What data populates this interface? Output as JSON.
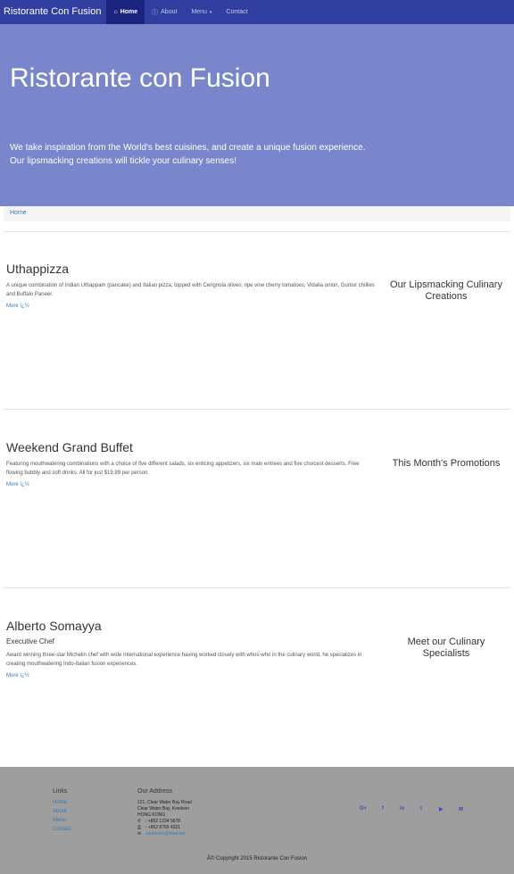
{
  "navbar": {
    "brand": "Ristorante Con Fusion",
    "items": [
      {
        "label": "Home",
        "icon": "home-icon",
        "glyph": "⌂"
      },
      {
        "label": "About",
        "icon": "info-icon",
        "glyph": "ⓘ"
      },
      {
        "label": "Menu",
        "icon": "caret-down-icon",
        "glyph": "▾"
      },
      {
        "label": "Contact"
      }
    ]
  },
  "jumbotron": {
    "title": "Ristorante con Fusion",
    "text": "We take inspiration from the World's best cuisines, and create a unique fusion experience. Our lipsmacking creations will tickle your culinary senses!"
  },
  "breadcrumb": {
    "home": "Home"
  },
  "items": [
    {
      "title": "Uthappizza",
      "description": "A unique combination of Indian Uthappam (pancake) and Italian pizza, topped with Cerignola olives, ripe vine cherry tomatoes, Vidalia onion, Guntur chillies and Buffalo Paneer.",
      "more": "More ï¿½",
      "side": "Our Lipsmacking Culinary Creations"
    },
    {
      "title": "Weekend Grand Buffet",
      "description": "Featuring mouthwatering combinations with a choice of five different salads, six enticing appetizers, six main entrees and five choicest desserts. Free flowing bubbly and soft drinks. All for just $19.99 per person",
      "more": "More ï¿½",
      "side": "This Month's Promotions"
    },
    {
      "title": "Alberto Somayya",
      "subtitle": "Executive Chef",
      "description": "Award winning three-star Michelin chef with wide International experience having worked closely with whos-who in the culinary world, he specializes in creating mouthwatering Indo-Italian fusion experiences.",
      "more": "More ï¿½",
      "side": "Meet our Culinary Specialists"
    }
  ],
  "footer": {
    "links_heading": "Links",
    "links": [
      "Home",
      "About",
      "Menu",
      "Contact"
    ],
    "address_heading": "Our Address",
    "address_lines": [
      "121, Clear Water Bay Road",
      "Clear Water Bay, Kowloon",
      "HONG KONG"
    ],
    "phone": ": +852 1234 5678",
    "fax": ": +852 8765 4321",
    "email": "confusion@food.net",
    "social": [
      "G+",
      "f",
      "in",
      "t",
      "▶",
      "✉"
    ],
    "copyright": "Â© Copyright 2015 Ristorante Con Fusion"
  }
}
